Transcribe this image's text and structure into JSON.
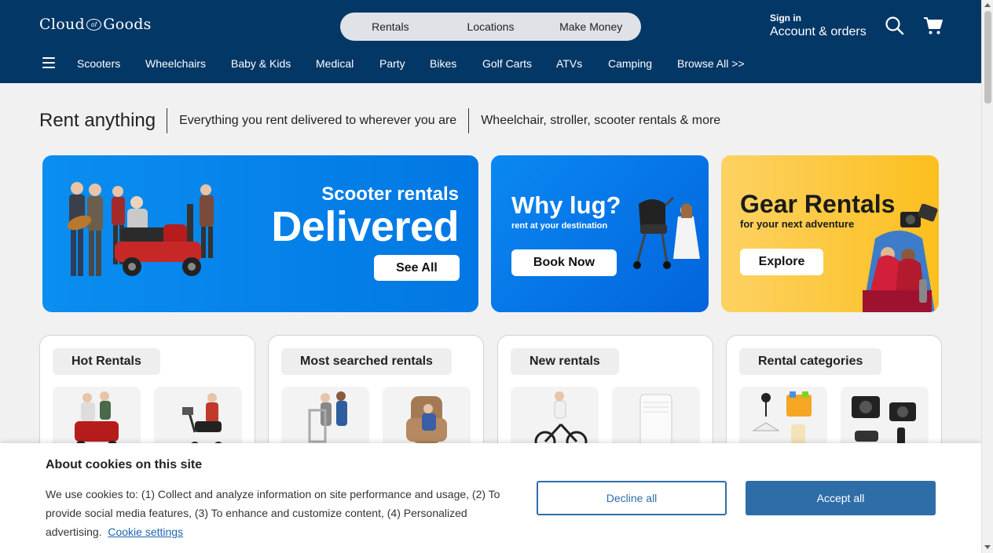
{
  "header": {
    "logo": {
      "left": "Cloud",
      "middle": "of",
      "right": "Goods"
    },
    "topnav": [
      "Rentals",
      "Locations",
      "Make Money"
    ],
    "signin_small": "Sign in",
    "signin_big": "Account & orders",
    "categories": [
      "Scooters",
      "Wheelchairs",
      "Baby & Kids",
      "Medical",
      "Party",
      "Bikes",
      "Golf Carts",
      "ATVs",
      "Camping",
      "Browse All >>"
    ]
  },
  "tagline": {
    "main": "Rent anything",
    "sub1": "Everything you rent delivered to wherever you are",
    "sub2": "Wheelchair, stroller, scooter rentals & more"
  },
  "banners": {
    "scooter": {
      "sub": "Scooter rentals",
      "title": "Delivered",
      "button": "See All"
    },
    "lug": {
      "title": "Why lug?",
      "sub": "rent at your destination",
      "button": "Book Now"
    },
    "gear": {
      "title": "Gear Rentals",
      "sub": "for your next adventure",
      "button": "Explore"
    }
  },
  "cards": [
    {
      "title": "Hot Rentals"
    },
    {
      "title": "Most searched rentals"
    },
    {
      "title": "New rentals"
    },
    {
      "title": "Rental categories"
    }
  ],
  "cookie": {
    "title": "About cookies on this site",
    "text": "We use cookies to: (1) Collect and analyze information on site performance and usage, (2) To provide social media features, (3) To enhance and customize content, (4) Personalized advertising.",
    "link": "Cookie settings",
    "decline": "Decline all",
    "accept": "Accept all"
  },
  "colors": {
    "header_bg": "#033766",
    "banner_blue": "#0277e3",
    "banner_yellow": "#fcbf1e",
    "accept_blue": "#2e6da8"
  }
}
